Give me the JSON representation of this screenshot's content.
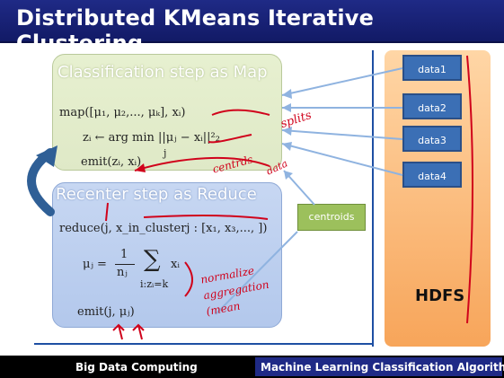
{
  "title": "Distributed KMeans Iterative Clustering",
  "footer": {
    "left": "Big Data Computing",
    "right": "Machine Learning Classification Algorithm"
  },
  "map": {
    "title": "Classification step as Map",
    "line1": "map([μ₁, μ₂,..., μₖ], xᵢ)",
    "line2": "zᵢ ← arg min ||μⱼ − xᵢ||²₂",
    "line2_sub": "j",
    "line3": "emit(zᵢ, xᵢ)"
  },
  "reduce": {
    "title": "Recenter step as Reduce",
    "line1": "reduce(j, x_in_clusterj : [x₁, x₃,..., ])",
    "line2_lhs": "μⱼ =",
    "line2_frac_num": "1",
    "line2_frac_den": "nⱼ",
    "line2_sum": "∑",
    "line2_sum_sub": "i:zᵢ=k",
    "line2_x": "xᵢ",
    "line3": "emit(j,  μⱼ)"
  },
  "centroids_label": "centroids",
  "hdfs": {
    "label": "HDFS",
    "items": [
      "data1",
      "data2",
      "data3",
      "data4"
    ]
  },
  "annotations": {
    "splits": "splits",
    "data": "data",
    "centroids_note": "centrds",
    "normalize": [
      "normalize",
      "aggregation",
      "(mean"
    ]
  },
  "colors": {
    "title_bar": "#1f2a86",
    "footer_right": "#1f2a86",
    "hdfs_panel": "#f7a55a",
    "data_box": "#3b6fb5",
    "map_box": "#dfe9c7",
    "reduce_box": "#b3c8ec",
    "centroids_box": "#9cc05c",
    "ink": "#d0021b"
  }
}
